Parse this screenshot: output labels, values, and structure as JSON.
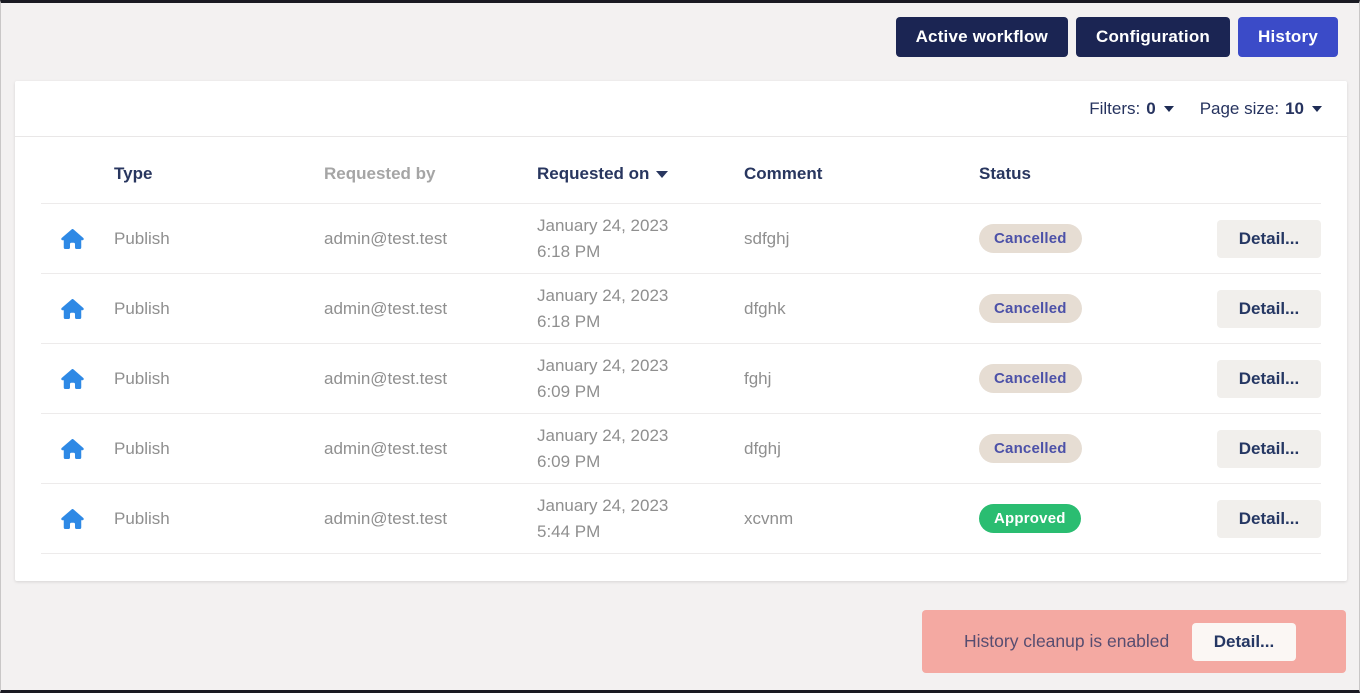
{
  "nav": {
    "buttons": [
      {
        "label": "Active workflow",
        "active": false
      },
      {
        "label": "Configuration",
        "active": false
      },
      {
        "label": "History",
        "active": true
      }
    ]
  },
  "toolbar": {
    "filters_label": "Filters:",
    "filters_value": "0",
    "page_size_label": "Page size:",
    "page_size_value": "10"
  },
  "table": {
    "columns": {
      "type": "Type",
      "requested_by": "Requested by",
      "requested_on": "Requested on",
      "comment": "Comment",
      "status": "Status"
    },
    "sorted_column": "Requested on",
    "sort_direction": "desc",
    "type_icon": "home-icon",
    "rows": [
      {
        "type": "Publish",
        "requested_by": "admin@test.test",
        "date": "January 24, 2023",
        "time": "6:18 PM",
        "comment": "sdfghj",
        "status": "Cancelled",
        "detail_label": "Detail..."
      },
      {
        "type": "Publish",
        "requested_by": "admin@test.test",
        "date": "January 24, 2023",
        "time": "6:18 PM",
        "comment": "dfghk",
        "status": "Cancelled",
        "detail_label": "Detail..."
      },
      {
        "type": "Publish",
        "requested_by": "admin@test.test",
        "date": "January 24, 2023",
        "time": "6:09 PM",
        "comment": "fghj",
        "status": "Cancelled",
        "detail_label": "Detail..."
      },
      {
        "type": "Publish",
        "requested_by": "admin@test.test",
        "date": "January 24, 2023",
        "time": "6:09 PM",
        "comment": "dfghj",
        "status": "Cancelled",
        "detail_label": "Detail..."
      },
      {
        "type": "Publish",
        "requested_by": "admin@test.test",
        "date": "January 24, 2023",
        "time": "5:44 PM",
        "comment": "xcvnm",
        "status": "Approved",
        "detail_label": "Detail..."
      }
    ]
  },
  "banner": {
    "text": "History cleanup is enabled",
    "button_label": "Detail..."
  },
  "colors": {
    "page_background": "#f3f1f1",
    "card_background": "#ffffff",
    "nav_button": "#1b2553",
    "nav_button_active": "#3b4bc8",
    "heading_text": "#28365f",
    "body_text": "#8f8f8f",
    "type_icon_blue": "#2e89e5",
    "badge_cancelled_bg": "#e6ddd3",
    "badge_cancelled_text": "#4c51a8",
    "badge_approved_bg": "#2abd71",
    "badge_approved_text": "#ffffff",
    "detail_button_bg": "#f1efec",
    "banner_bg": "#f4a9a2",
    "banner_text": "#574d70"
  }
}
